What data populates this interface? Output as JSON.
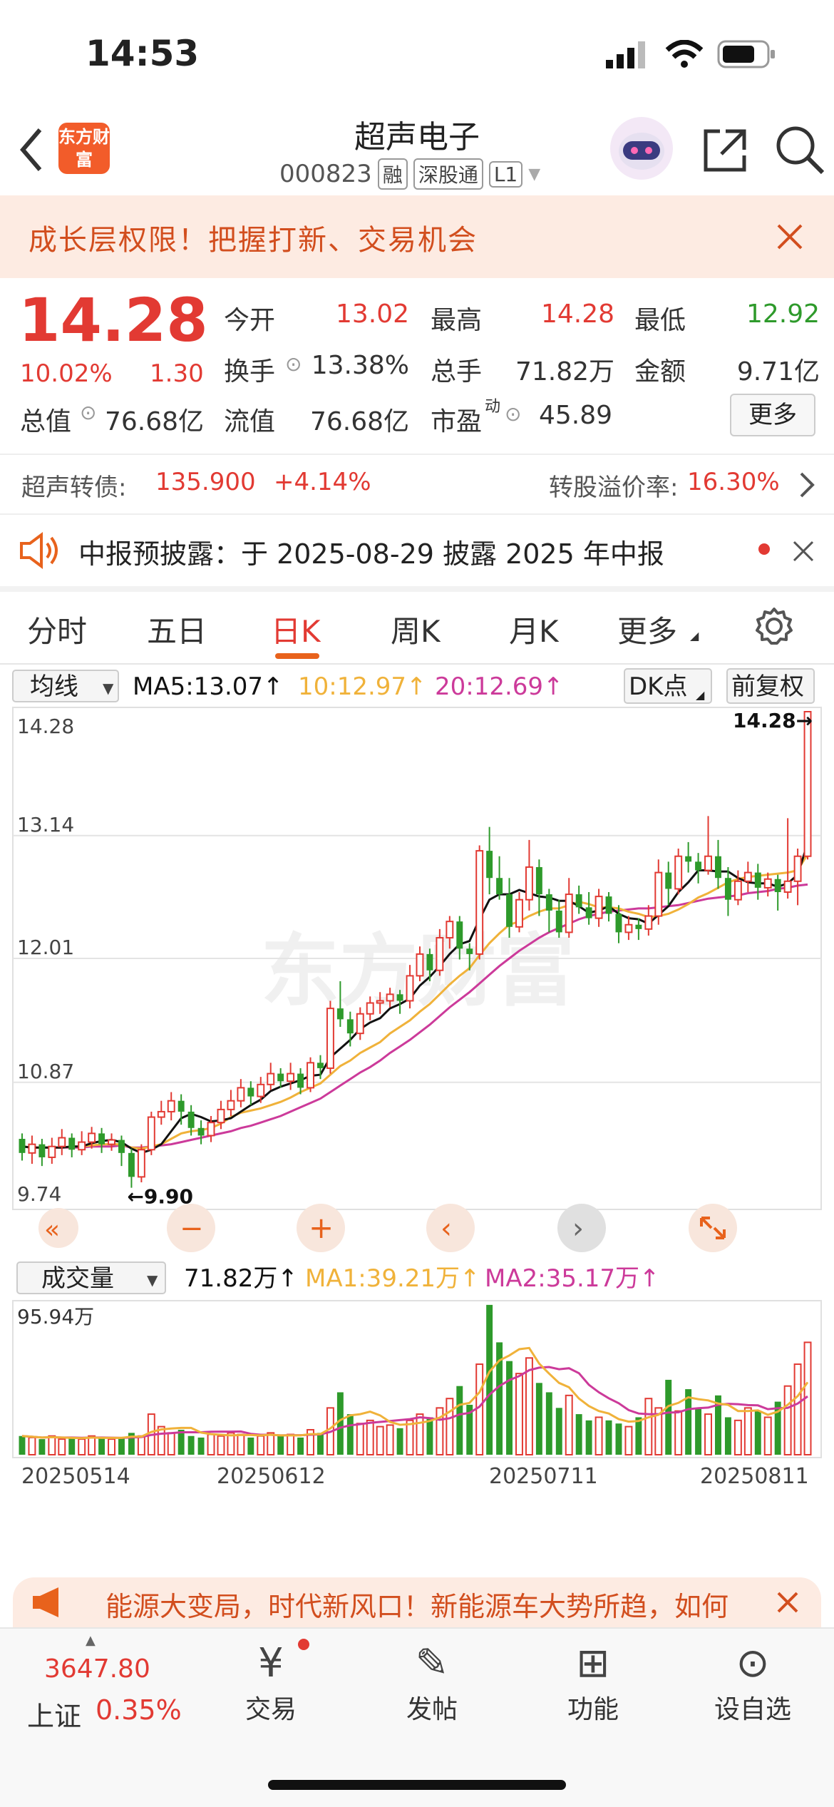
{
  "status_bar": {
    "time": "14:53"
  },
  "header": {
    "logo_text": "东方财富",
    "title": "超声电子",
    "code": "000823",
    "tags": [
      "融",
      "深股通",
      "L1"
    ]
  },
  "banner": {
    "text": "成长层权限！把握打新、交易机会"
  },
  "quote": {
    "price": "14.28",
    "change_pct": "10.02%",
    "change": "1.30",
    "items": [
      {
        "label": "今开",
        "value": "13.02",
        "color": "#e23a33"
      },
      {
        "label": "最高",
        "value": "14.28",
        "color": "#e23a33"
      },
      {
        "label": "最低",
        "value": "12.92",
        "color": "#2e9a2b"
      },
      {
        "label": "换手",
        "value": "13.38%",
        "color": "#333333"
      },
      {
        "label": "总手",
        "value": "71.82万",
        "color": "#333333"
      },
      {
        "label": "金额",
        "value": "9.71亿",
        "color": "#333333"
      },
      {
        "label": "总值",
        "value": "76.68亿",
        "color": "#333333"
      },
      {
        "label": "流值",
        "value": "76.68亿",
        "color": "#333333"
      },
      {
        "label": "市盈",
        "value": "45.89",
        "color": "#333333"
      }
    ],
    "pe_superscript": "动",
    "more_label": "更多"
  },
  "bond": {
    "label": "超声转债:",
    "price": "135.900",
    "change": "+4.14%",
    "premium_label": "转股溢价率:",
    "premium_value": "16.30%"
  },
  "notice": {
    "text": "中报预披露：于 2025-08-29 披露 2025 年中报"
  },
  "tabs": [
    "分时",
    "五日",
    "日K",
    "周K",
    "月K",
    "更多"
  ],
  "active_tab": "日K",
  "kline": {
    "indicator_select": "均线",
    "ma5": "MA5:13.07↑",
    "ma10": "10:12.97↑",
    "ma20": "20:12.69↑",
    "dk_label": "DK点",
    "adjust_label": "前复权",
    "ylabels": [
      "14.28",
      "13.14",
      "12.01",
      "10.87",
      "9.74"
    ],
    "high_mark": "14.28→",
    "low_mark": "←9.90",
    "watermark": "东方财富"
  },
  "volume": {
    "select": "成交量",
    "value": "71.82万↑",
    "ma1": "MA1:39.21万↑",
    "ma2": "MA2:35.17万↑",
    "ylabel": "95.94万",
    "dates": [
      "20250514",
      "20250612",
      "20250711",
      "20250811"
    ]
  },
  "colors": {
    "up": "#e23a33",
    "down": "#2e9a2b",
    "ma5": "#111111",
    "ma10": "#f0b23a",
    "ma20": "#cc3a9a"
  },
  "chart_data": {
    "type": "candlestick",
    "ylim": [
      9.74,
      14.28
    ],
    "candles": [
      {
        "o": 10.35,
        "c": 10.22,
        "h": 10.4,
        "l": 10.15
      },
      {
        "o": 10.22,
        "c": 10.3,
        "h": 10.38,
        "l": 10.12
      },
      {
        "o": 10.3,
        "c": 10.18,
        "h": 10.35,
        "l": 10.1
      },
      {
        "o": 10.18,
        "c": 10.28,
        "h": 10.36,
        "l": 10.12
      },
      {
        "o": 10.28,
        "c": 10.36,
        "h": 10.44,
        "l": 10.2
      },
      {
        "o": 10.36,
        "c": 10.25,
        "h": 10.4,
        "l": 10.18
      },
      {
        "o": 10.25,
        "c": 10.32,
        "h": 10.42,
        "l": 10.2
      },
      {
        "o": 10.32,
        "c": 10.4,
        "h": 10.46,
        "l": 10.26
      },
      {
        "o": 10.4,
        "c": 10.3,
        "h": 10.45,
        "l": 10.22
      },
      {
        "o": 10.3,
        "c": 10.34,
        "h": 10.4,
        "l": 10.24
      },
      {
        "o": 10.34,
        "c": 10.22,
        "h": 10.38,
        "l": 10.1
      },
      {
        "o": 10.22,
        "c": 10.0,
        "h": 10.26,
        "l": 9.9
      },
      {
        "o": 10.0,
        "c": 10.25,
        "h": 10.3,
        "l": 9.95
      },
      {
        "o": 10.25,
        "c": 10.55,
        "h": 10.6,
        "l": 10.2
      },
      {
        "o": 10.55,
        "c": 10.6,
        "h": 10.7,
        "l": 10.48
      },
      {
        "o": 10.6,
        "c": 10.7,
        "h": 10.78,
        "l": 10.52
      },
      {
        "o": 10.7,
        "c": 10.6,
        "h": 10.76,
        "l": 10.48
      },
      {
        "o": 10.6,
        "c": 10.45,
        "h": 10.66,
        "l": 10.38
      },
      {
        "o": 10.45,
        "c": 10.38,
        "h": 10.52,
        "l": 10.3
      },
      {
        "o": 10.38,
        "c": 10.5,
        "h": 10.56,
        "l": 10.32
      },
      {
        "o": 10.5,
        "c": 10.62,
        "h": 10.7,
        "l": 10.44
      },
      {
        "o": 10.62,
        "c": 10.7,
        "h": 10.8,
        "l": 10.56
      },
      {
        "o": 10.7,
        "c": 10.82,
        "h": 10.9,
        "l": 10.64
      },
      {
        "o": 10.82,
        "c": 10.74,
        "h": 10.88,
        "l": 10.66
      },
      {
        "o": 10.74,
        "c": 10.85,
        "h": 10.92,
        "l": 10.68
      },
      {
        "o": 10.85,
        "c": 10.95,
        "h": 11.05,
        "l": 10.8
      },
      {
        "o": 10.95,
        "c": 10.88,
        "h": 11.0,
        "l": 10.82
      },
      {
        "o": 10.88,
        "c": 10.95,
        "h": 11.05,
        "l": 10.8
      },
      {
        "o": 10.95,
        "c": 10.82,
        "h": 11.0,
        "l": 10.76
      },
      {
        "o": 10.82,
        "c": 11.05,
        "h": 11.1,
        "l": 10.78
      },
      {
        "o": 11.05,
        "c": 11.0,
        "h": 11.12,
        "l": 10.9
      },
      {
        "o": 11.0,
        "c": 11.55,
        "h": 11.62,
        "l": 10.95
      },
      {
        "o": 11.55,
        "c": 11.45,
        "h": 11.8,
        "l": 11.38
      },
      {
        "o": 11.45,
        "c": 11.32,
        "h": 11.52,
        "l": 11.2
      },
      {
        "o": 11.32,
        "c": 11.5,
        "h": 11.56,
        "l": 11.26
      },
      {
        "o": 11.5,
        "c": 11.6,
        "h": 11.66,
        "l": 11.44
      },
      {
        "o": 11.6,
        "c": 11.62,
        "h": 11.7,
        "l": 11.5
      },
      {
        "o": 11.62,
        "c": 11.68,
        "h": 11.74,
        "l": 11.56
      },
      {
        "o": 11.68,
        "c": 11.62,
        "h": 11.72,
        "l": 11.5
      },
      {
        "o": 11.62,
        "c": 11.85,
        "h": 11.95,
        "l": 11.55
      },
      {
        "o": 11.85,
        "c": 12.05,
        "h": 12.12,
        "l": 11.8
      },
      {
        "o": 12.05,
        "c": 11.9,
        "h": 12.1,
        "l": 11.8
      },
      {
        "o": 11.9,
        "c": 12.2,
        "h": 12.28,
        "l": 11.85
      },
      {
        "o": 12.2,
        "c": 12.35,
        "h": 12.4,
        "l": 12.1
      },
      {
        "o": 12.35,
        "c": 12.1,
        "h": 12.4,
        "l": 12.0
      },
      {
        "o": 12.1,
        "c": 12.05,
        "h": 12.15,
        "l": 11.9
      },
      {
        "o": 12.05,
        "c": 13.0,
        "h": 13.05,
        "l": 12.0
      },
      {
        "o": 13.0,
        "c": 12.75,
        "h": 13.22,
        "l": 12.6
      },
      {
        "o": 12.75,
        "c": 12.6,
        "h": 12.95,
        "l": 12.55
      },
      {
        "o": 12.6,
        "c": 12.3,
        "h": 12.75,
        "l": 12.2
      },
      {
        "o": 12.3,
        "c": 12.55,
        "h": 12.62,
        "l": 12.25
      },
      {
        "o": 12.55,
        "c": 12.85,
        "h": 13.1,
        "l": 12.45
      },
      {
        "o": 12.85,
        "c": 12.6,
        "h": 12.92,
        "l": 12.4
      },
      {
        "o": 12.6,
        "c": 12.45,
        "h": 12.65,
        "l": 12.25
      },
      {
        "o": 12.45,
        "c": 12.25,
        "h": 12.55,
        "l": 12.2
      },
      {
        "o": 12.25,
        "c": 12.6,
        "h": 12.75,
        "l": 12.2
      },
      {
        "o": 12.6,
        "c": 12.48,
        "h": 12.68,
        "l": 12.42
      },
      {
        "o": 12.48,
        "c": 12.38,
        "h": 12.62,
        "l": 12.32
      },
      {
        "o": 12.38,
        "c": 12.58,
        "h": 12.65,
        "l": 12.3
      },
      {
        "o": 12.58,
        "c": 12.42,
        "h": 12.62,
        "l": 12.35
      },
      {
        "o": 12.42,
        "c": 12.25,
        "h": 12.5,
        "l": 12.15
      },
      {
        "o": 12.25,
        "c": 12.32,
        "h": 12.4,
        "l": 12.18
      },
      {
        "o": 12.32,
        "c": 12.28,
        "h": 12.38,
        "l": 12.18
      },
      {
        "o": 12.28,
        "c": 12.4,
        "h": 12.5,
        "l": 12.22
      },
      {
        "o": 12.4,
        "c": 12.8,
        "h": 12.92,
        "l": 12.32
      },
      {
        "o": 12.8,
        "c": 12.65,
        "h": 12.9,
        "l": 12.5
      },
      {
        "o": 12.65,
        "c": 12.95,
        "h": 13.02,
        "l": 12.6
      },
      {
        "o": 12.95,
        "c": 12.9,
        "h": 13.08,
        "l": 12.8
      },
      {
        "o": 12.9,
        "c": 12.82,
        "h": 12.98,
        "l": 12.7
      },
      {
        "o": 12.82,
        "c": 12.95,
        "h": 13.32,
        "l": 12.78
      },
      {
        "o": 12.95,
        "c": 12.75,
        "h": 13.1,
        "l": 12.65
      },
      {
        "o": 12.75,
        "c": 12.55,
        "h": 12.85,
        "l": 12.4
      },
      {
        "o": 12.55,
        "c": 12.72,
        "h": 12.82,
        "l": 12.5
      },
      {
        "o": 12.72,
        "c": 12.8,
        "h": 12.9,
        "l": 12.62
      },
      {
        "o": 12.8,
        "c": 12.66,
        "h": 12.88,
        "l": 12.55
      },
      {
        "o": 12.66,
        "c": 12.74,
        "h": 12.8,
        "l": 12.58
      },
      {
        "o": 12.74,
        "c": 12.62,
        "h": 12.78,
        "l": 12.45
      },
      {
        "o": 12.62,
        "c": 12.72,
        "h": 13.3,
        "l": 12.56
      },
      {
        "o": 12.72,
        "c": 12.95,
        "h": 13.02,
        "l": 12.5
      },
      {
        "o": 12.95,
        "c": 14.28,
        "h": 14.28,
        "l": 12.92
      }
    ],
    "ma5": [
      10.28,
      10.27,
      10.27,
      10.27,
      10.27,
      10.28,
      10.28,
      10.31,
      10.33,
      10.34,
      10.32,
      10.26,
      10.22,
      10.25,
      10.3,
      10.42,
      10.54,
      10.58,
      10.55,
      10.51,
      10.52,
      10.54,
      10.6,
      10.66,
      10.71,
      10.79,
      10.83,
      10.86,
      10.89,
      10.93,
      10.94,
      11.1,
      11.18,
      11.26,
      11.36,
      11.42,
      11.46,
      11.55,
      11.59,
      11.64,
      11.76,
      11.84,
      11.94,
      12.05,
      12.14,
      12.17,
      12.37,
      12.55,
      12.6,
      12.6,
      12.64,
      12.61,
      12.58,
      12.57,
      12.54,
      12.54,
      12.49,
      12.43,
      12.45,
      12.49,
      12.42,
      12.38,
      12.37,
      12.33,
      12.41,
      12.49,
      12.62,
      12.71,
      12.82,
      12.82,
      12.81,
      12.81,
      12.75,
      12.71,
      12.7,
      12.7,
      12.67,
      12.7,
      12.78,
      13.07
    ],
    "ma10": [
      10.28,
      10.27,
      10.27,
      10.27,
      10.27,
      10.28,
      10.28,
      10.29,
      10.3,
      10.3,
      10.3,
      10.27,
      10.26,
      10.28,
      10.3,
      10.35,
      10.4,
      10.42,
      10.43,
      10.45,
      10.49,
      10.55,
      10.59,
      10.61,
      10.63,
      10.66,
      10.69,
      10.73,
      10.78,
      10.82,
      10.86,
      10.94,
      11.02,
      11.07,
      11.14,
      11.19,
      11.24,
      11.32,
      11.38,
      11.44,
      11.52,
      11.59,
      11.68,
      11.77,
      11.85,
      11.92,
      12.04,
      12.15,
      12.24,
      12.32,
      12.35,
      12.4,
      12.44,
      12.47,
      12.47,
      12.5,
      12.53,
      12.51,
      12.48,
      12.48,
      12.47,
      12.44,
      12.42,
      12.39,
      12.4,
      12.42,
      12.46,
      12.51,
      12.57,
      12.61,
      12.66,
      12.71,
      12.74,
      12.76,
      12.77,
      12.78,
      12.79,
      12.8,
      12.82,
      12.97
    ],
    "ma20": [
      10.28,
      10.27,
      10.27,
      10.27,
      10.27,
      10.27,
      10.27,
      10.28,
      10.28,
      10.28,
      10.29,
      10.27,
      10.27,
      10.28,
      10.29,
      10.3,
      10.32,
      10.34,
      10.36,
      10.38,
      10.4,
      10.42,
      10.45,
      10.47,
      10.5,
      10.53,
      10.56,
      10.6,
      10.64,
      10.68,
      10.72,
      10.78,
      10.84,
      10.9,
      10.96,
      11.01,
      11.07,
      11.14,
      11.2,
      11.26,
      11.33,
      11.4,
      11.48,
      11.56,
      11.63,
      11.7,
      11.78,
      11.86,
      11.94,
      12.01,
      12.08,
      12.14,
      12.2,
      12.25,
      12.29,
      12.33,
      12.37,
      12.4,
      12.42,
      12.44,
      12.45,
      12.46,
      12.47,
      12.47,
      12.48,
      12.49,
      12.5,
      12.52,
      12.54,
      12.56,
      12.57,
      12.58,
      12.59,
      12.61,
      12.62,
      12.63,
      12.65,
      12.66,
      12.68,
      12.69
    ],
    "volume": {
      "ylim": [
        0,
        95.94
      ],
      "unit": "万",
      "values": [
        12,
        11,
        10,
        12,
        10,
        11,
        10,
        12,
        11,
        10,
        11,
        14,
        12,
        26,
        18,
        14,
        16,
        12,
        11,
        13,
        12,
        14,
        13,
        11,
        12,
        14,
        12,
        13,
        11,
        16,
        14,
        30,
        40,
        26,
        20,
        22,
        18,
        19,
        17,
        22,
        26,
        24,
        30,
        36,
        44,
        32,
        58,
        96,
        72,
        60,
        52,
        62,
        46,
        40,
        30,
        38,
        26,
        22,
        24,
        22,
        20,
        18,
        24,
        36,
        30,
        48,
        28,
        42,
        30,
        26,
        38,
        24,
        22,
        30,
        28,
        24,
        34,
        44,
        58,
        72
      ]
    }
  }
}
